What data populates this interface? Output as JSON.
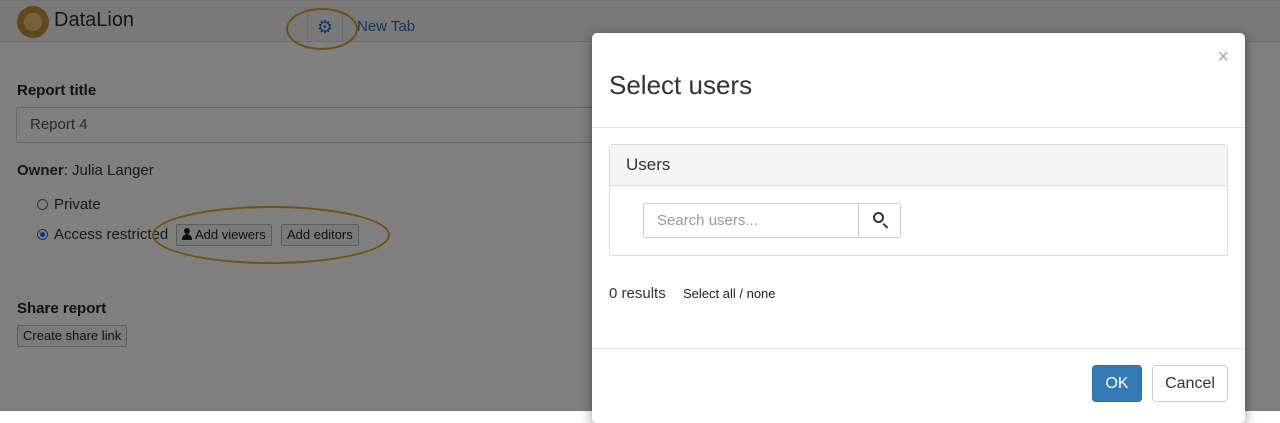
{
  "header": {
    "brand": "DataLion",
    "settings_icon": "gear-icon",
    "tab_label": "New Tab"
  },
  "form": {
    "report_title_label": "Report title",
    "report_title_value": "Report 4",
    "owner_label": "Owner",
    "owner_name": ": Julia Langer",
    "access_options": [
      {
        "label": "Private",
        "selected": false
      },
      {
        "label": "Access restricted",
        "selected": true
      }
    ],
    "add_viewers_label": "Add viewers",
    "add_editors_label": "Add editors",
    "share_heading": "Share report",
    "share_link_label": "Create share link"
  },
  "modal": {
    "title": "Select users",
    "close_glyph": "×",
    "panel_heading": "Users",
    "search_placeholder": "Search users...",
    "results_text": "0 results",
    "select_all_text": "Select all / none",
    "ok_label": "OK",
    "cancel_label": "Cancel"
  },
  "colors": {
    "accent": "#337ab7",
    "highlight": "#e1a31f",
    "link": "#2a6fb4"
  }
}
